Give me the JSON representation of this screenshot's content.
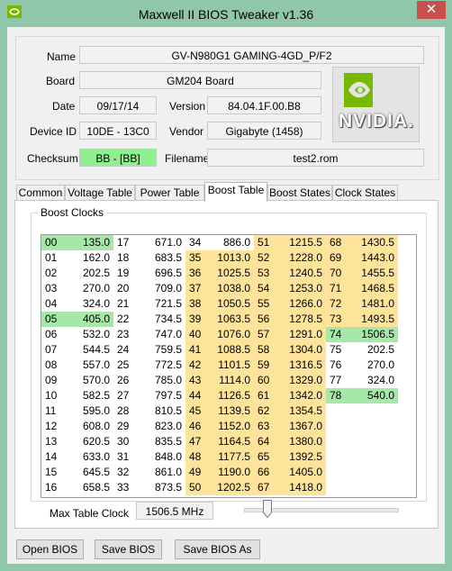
{
  "window": {
    "title": "Maxwell II BIOS Tweaker v1.36",
    "close_glyph": "✕"
  },
  "info": {
    "name_label": "Name",
    "name_value": "GV-N980G1 GAMING-4GD_P/F2",
    "board_label": "Board",
    "board_value": "GM204 Board",
    "date_label": "Date",
    "date_value": "09/17/14",
    "version_label": "Version",
    "version_value": "84.04.1F.00.B8",
    "device_label": "Device ID",
    "device_value": "10DE - 13C0",
    "vendor_label": "Vendor",
    "vendor_value": "Gigabyte (1458)",
    "checksum_label": "Checksum",
    "checksum_value": "BB - [BB]",
    "filename_label": "Filename",
    "filename_value": "test2.rom"
  },
  "logo": {
    "icon": "nvidia-logo",
    "text": "NVIDIA."
  },
  "tabs": [
    "Common",
    "Voltage Table",
    "Power Table",
    "Boost Table",
    "Boost States",
    "Clock States"
  ],
  "active_tab": "Boost Table",
  "boost": {
    "group_label": "Boost Clocks",
    "rows": [
      [
        [
          "00",
          "135.0",
          "green"
        ],
        [
          "17",
          "671.0",
          ""
        ],
        [
          "34",
          "886.0",
          ""
        ],
        [
          "51",
          "1215.5",
          "yellow"
        ],
        [
          "68",
          "1430.5",
          "yellow"
        ]
      ],
      [
        [
          "01",
          "162.0",
          ""
        ],
        [
          "18",
          "683.5",
          ""
        ],
        [
          "35",
          "1013.0",
          "yellow"
        ],
        [
          "52",
          "1228.0",
          "yellow"
        ],
        [
          "69",
          "1443.0",
          "yellow"
        ]
      ],
      [
        [
          "02",
          "202.5",
          ""
        ],
        [
          "19",
          "696.5",
          ""
        ],
        [
          "36",
          "1025.5",
          "yellow"
        ],
        [
          "53",
          "1240.5",
          "yellow"
        ],
        [
          "70",
          "1455.5",
          "yellow"
        ]
      ],
      [
        [
          "03",
          "270.0",
          ""
        ],
        [
          "20",
          "709.0",
          ""
        ],
        [
          "37",
          "1038.0",
          "yellow"
        ],
        [
          "54",
          "1253.0",
          "yellow"
        ],
        [
          "71",
          "1468.5",
          "yellow"
        ]
      ],
      [
        [
          "04",
          "324.0",
          ""
        ],
        [
          "21",
          "721.5",
          ""
        ],
        [
          "38",
          "1050.5",
          "yellow"
        ],
        [
          "55",
          "1266.0",
          "yellow"
        ],
        [
          "72",
          "1481.0",
          "yellow"
        ]
      ],
      [
        [
          "05",
          "405.0",
          "green"
        ],
        [
          "22",
          "734.5",
          ""
        ],
        [
          "39",
          "1063.5",
          "yellow"
        ],
        [
          "56",
          "1278.5",
          "yellow"
        ],
        [
          "73",
          "1493.5",
          "yellow"
        ]
      ],
      [
        [
          "06",
          "532.0",
          ""
        ],
        [
          "23",
          "747.0",
          ""
        ],
        [
          "40",
          "1076.0",
          "yellow"
        ],
        [
          "57",
          "1291.0",
          "yellow"
        ],
        [
          "74",
          "1506.5",
          "green"
        ]
      ],
      [
        [
          "07",
          "544.5",
          ""
        ],
        [
          "24",
          "759.5",
          ""
        ],
        [
          "41",
          "1088.5",
          "yellow"
        ],
        [
          "58",
          "1304.0",
          "yellow"
        ],
        [
          "75",
          "202.5",
          ""
        ]
      ],
      [
        [
          "08",
          "557.0",
          ""
        ],
        [
          "25",
          "772.5",
          ""
        ],
        [
          "42",
          "1101.5",
          "yellow"
        ],
        [
          "59",
          "1316.5",
          "yellow"
        ],
        [
          "76",
          "270.0",
          ""
        ]
      ],
      [
        [
          "09",
          "570.0",
          ""
        ],
        [
          "26",
          "785.0",
          ""
        ],
        [
          "43",
          "1114.0",
          "yellow"
        ],
        [
          "60",
          "1329.0",
          "yellow"
        ],
        [
          "77",
          "324.0",
          ""
        ]
      ],
      [
        [
          "10",
          "582.5",
          ""
        ],
        [
          "27",
          "797.5",
          ""
        ],
        [
          "44",
          "1126.5",
          "yellow"
        ],
        [
          "61",
          "1342.0",
          "yellow"
        ],
        [
          "78",
          "540.0",
          "green"
        ]
      ],
      [
        [
          "11",
          "595.0",
          ""
        ],
        [
          "28",
          "810.5",
          ""
        ],
        [
          "45",
          "1139.5",
          "yellow"
        ],
        [
          "62",
          "1354.5",
          "yellow"
        ],
        [
          "",
          "",
          " "
        ]
      ],
      [
        [
          "12",
          "608.0",
          ""
        ],
        [
          "29",
          "823.0",
          ""
        ],
        [
          "46",
          "1152.0",
          "yellow"
        ],
        [
          "63",
          "1367.0",
          "yellow"
        ],
        [
          "",
          "",
          " "
        ]
      ],
      [
        [
          "13",
          "620.5",
          ""
        ],
        [
          "30",
          "835.5",
          ""
        ],
        [
          "47",
          "1164.5",
          "yellow"
        ],
        [
          "64",
          "1380.0",
          "yellow"
        ],
        [
          "",
          "",
          " "
        ]
      ],
      [
        [
          "14",
          "633.0",
          ""
        ],
        [
          "31",
          "848.0",
          ""
        ],
        [
          "48",
          "1177.5",
          "yellow"
        ],
        [
          "65",
          "1392.5",
          "yellow"
        ],
        [
          "",
          "",
          " "
        ]
      ],
      [
        [
          "15",
          "645.5",
          ""
        ],
        [
          "32",
          "861.0",
          ""
        ],
        [
          "49",
          "1190.0",
          "yellow"
        ],
        [
          "66",
          "1405.0",
          "yellow"
        ],
        [
          "",
          "",
          " "
        ]
      ],
      [
        [
          "16",
          "658.5",
          ""
        ],
        [
          "33",
          "873.5",
          ""
        ],
        [
          "50",
          "1202.5",
          "yellow"
        ],
        [
          "67",
          "1418.0",
          "yellow"
        ],
        [
          "",
          "",
          " "
        ]
      ]
    ],
    "max_label": "Max Table Clock",
    "max_value": "1506.5 MHz",
    "slider_level": 0.15
  },
  "buttons": {
    "open": "Open BIOS",
    "save": "Save BIOS",
    "save_as": "Save BIOS As"
  },
  "colors": {
    "frame": "#8fc7a8",
    "highlight_green": "#a6e8a8",
    "highlight_yellow": "#fde49a",
    "checksum_green": "#8ff08f"
  }
}
